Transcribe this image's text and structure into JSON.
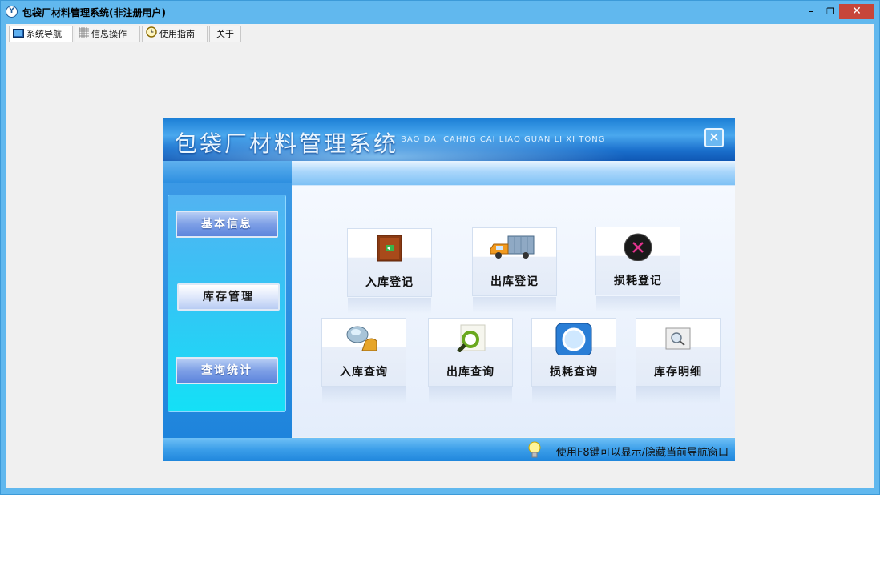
{
  "window": {
    "title": "包袋厂材料管理系统(非注册用户)",
    "controls": {
      "minimize": "–",
      "maximize": "❐",
      "close": "✕"
    }
  },
  "tabs": [
    {
      "label": "系统导航",
      "icon": "monitor-icon"
    },
    {
      "label": "信息操作",
      "icon": "grid-icon"
    },
    {
      "label": "使用指南",
      "icon": "clock-icon"
    },
    {
      "label": "关于",
      "icon": ""
    }
  ],
  "panel": {
    "title": "包袋厂材料管理系统",
    "subtitle": "BAO DAI CAHNG CAI LIAO GUAN LI XI TONG",
    "close_label": "✕",
    "side_buttons": [
      "基本信息",
      "库存管理",
      "查询统计"
    ],
    "selected_side_button": "库存管理",
    "cards": [
      {
        "label": "入库登记",
        "icon": "door-entry-icon"
      },
      {
        "label": "出库登记",
        "icon": "truck-icon"
      },
      {
        "label": "损耗登记",
        "icon": "loss-x-icon"
      },
      {
        "label": "入库查询",
        "icon": "search-hand-icon"
      },
      {
        "label": "出库查询",
        "icon": "magnifier-icon"
      },
      {
        "label": "损耗查询",
        "icon": "blue-search-icon"
      },
      {
        "label": "库存明细",
        "icon": "document-search-icon"
      }
    ],
    "status_text": "使用F8键可以显示/隐藏当前导航窗口",
    "status_icon": "lightbulb-icon"
  },
  "colors": {
    "titlebar": "#61b8ee",
    "close_button": "#c7463a",
    "banner": "#1c7fd6",
    "side_gradient_end": "#14e0f6"
  }
}
